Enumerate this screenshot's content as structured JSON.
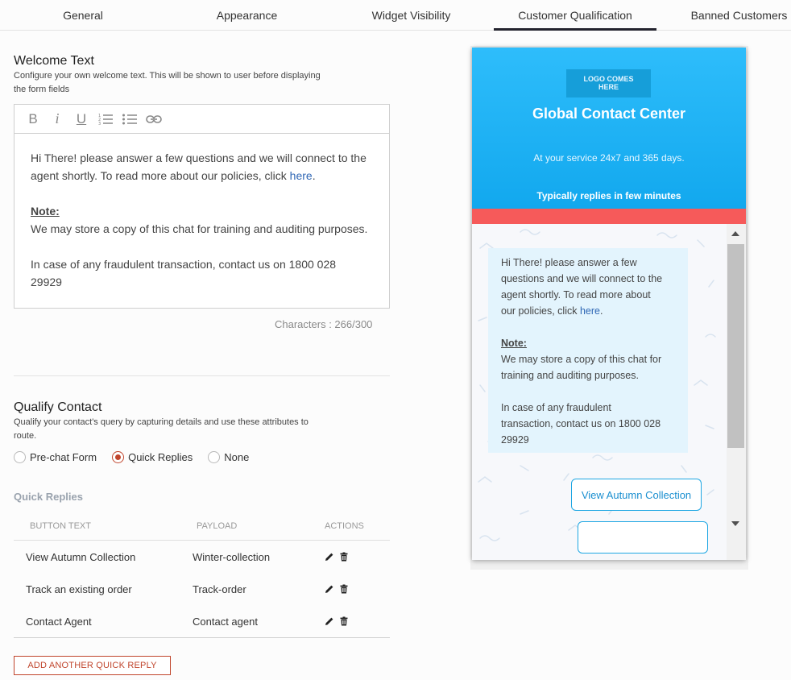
{
  "tabs": [
    {
      "label": "General"
    },
    {
      "label": "Appearance"
    },
    {
      "label": "Widget Visibility"
    },
    {
      "label": "Customer Qualification",
      "active": true
    },
    {
      "label": "Banned Customers"
    }
  ],
  "welcome": {
    "title": "Welcome Text",
    "description_line1": "Configure your own welcome text. This will be shown to user before displaying",
    "description_line2": "the form fields",
    "toolbar": [
      "bold-icon",
      "italic-icon",
      "underline-icon",
      "numbered-list-icon",
      "bulleted-list-icon",
      "link-icon"
    ],
    "toolbar_glyphs": {
      "bold": "B",
      "italic": "i",
      "underline": "U"
    },
    "body_line1": "Hi There! please answer a few questions and we will connect to the",
    "body_line2_prefix": "agent shortly. To read more about our policies, click ",
    "body_link": "here",
    "body_line2_suffix": ".",
    "note_label": "Note:",
    "note_text": "We may store a copy of this chat for training and auditing purposes.",
    "fraud_line1": "In case of any fraudulent transaction, contact us on 1800 028",
    "fraud_line2": "29929",
    "char_count": "Characters : 266/300"
  },
  "qualify": {
    "title": "Qualify Contact",
    "description_line1": "Qualify your contact's query by capturing details and use these attributes to",
    "description_line2": "route.",
    "options": [
      {
        "label": "Pre-chat Form",
        "selected": false
      },
      {
        "label": "Quick Replies",
        "selected": true
      },
      {
        "label": "None",
        "selected": false
      }
    ]
  },
  "quick_replies": {
    "heading": "Quick Replies",
    "columns": [
      "BUTTON TEXT",
      "PAYLOAD",
      "ACTIONS"
    ],
    "rows": [
      {
        "button_text": "View Autumn Collection",
        "payload": "Winter-collection"
      },
      {
        "button_text": "Track an existing order",
        "payload": "Track-order"
      },
      {
        "button_text": "Contact Agent",
        "payload": "Contact agent"
      }
    ],
    "add_button": "ADD ANOTHER QUICK REPLY"
  },
  "preview": {
    "logo_line1": "LOGO COMES",
    "logo_line2": "HERE",
    "title": "Global Contact Center",
    "subtitle": "At your service 24x7 and 365 days.",
    "replies_note": "Typically replies in few minutes",
    "bubble_line1": "Hi There! please answer a few",
    "bubble_line2": "questions and we will connect to the",
    "bubble_line3": "agent shortly. To read more about",
    "bubble_line4_prefix": "our policies, click ",
    "bubble_link": "here",
    "bubble_line4_suffix": ".",
    "bubble_note_label": "Note:",
    "bubble_note_line1": "We may store a copy of this chat for",
    "bubble_note_line2": "training and auditing purposes.",
    "bubble_fraud_line1": "In case of any fraudulent",
    "bubble_fraud_line2": "transaction, contact us on 1800 028",
    "bubble_fraud_line3": "29929",
    "quick_reply_button": "View Autumn Collection"
  },
  "colors": {
    "accent": "#c0452c",
    "header_blue": "#1aaef3",
    "red_band": "#f65a5a",
    "link": "#2f67b5"
  }
}
